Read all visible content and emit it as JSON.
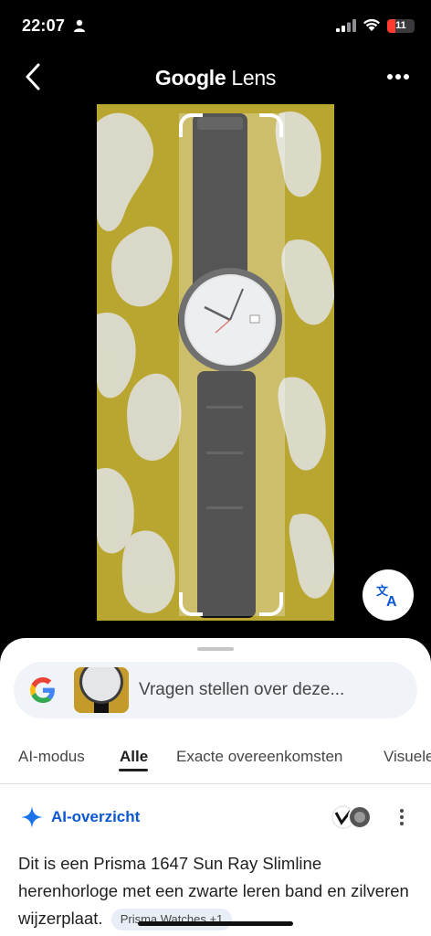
{
  "status_bar": {
    "time": "22:07",
    "battery_level": "11",
    "battery_fraction": 0.11
  },
  "header": {
    "title_brand": "Google",
    "title_product": "Lens"
  },
  "icons": {
    "back": "chevron-left-icon",
    "more": "more-horizontal-icon",
    "translate": "translate-icon",
    "sparkle": "sparkle-icon",
    "menu": "more-vertical-icon"
  },
  "search": {
    "placeholder": "Vragen stellen over deze..."
  },
  "tabs": [
    {
      "label": "AI-modus",
      "active": false
    },
    {
      "label": "Alle",
      "active": true
    },
    {
      "label": "Exacte overeenkomsten",
      "active": false
    },
    {
      "label": "Visuele",
      "active": false
    }
  ],
  "ai_overview": {
    "title": "AI-overzicht",
    "text": "Dit is een Prisma 1647 Sun Ray Slimline herenhorloge met een zwarte leren band en zilveren wijzerplaat.",
    "chip": "Prisma Watches +1"
  },
  "colors": {
    "accent": "#0b57d0",
    "battery": "#ff3b30",
    "sheet": "#ffffff"
  }
}
